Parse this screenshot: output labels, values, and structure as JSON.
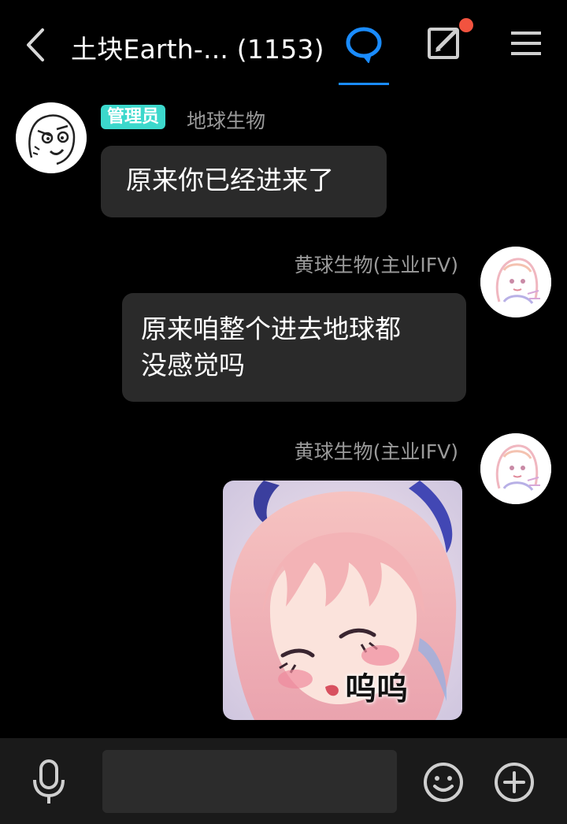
{
  "header": {
    "title": "土块Earth-... (1153)",
    "accent_color": "#1a8cff",
    "notification_dot_color": "#f2533f",
    "icons": [
      "back-icon",
      "chat-bubble-icon",
      "edit-icon",
      "menu-icon"
    ]
  },
  "messages": [
    {
      "badge": "管理员",
      "badge_color": "#3cd8cc",
      "sender": "地球生物",
      "text": "原来你已经进来了",
      "side": "left"
    },
    {
      "sender": "黄球生物(主业IFV)",
      "text_line1": "原来咱整个进去地球都",
      "text_line2": "没感觉吗",
      "side": "right"
    },
    {
      "sender": "黄球生物(主业IFV)",
      "image_caption": "呜呜",
      "side": "right"
    }
  ],
  "input_bar": {
    "placeholder": "",
    "icons": [
      "microphone-icon",
      "emoji-icon",
      "plus-icon"
    ]
  }
}
